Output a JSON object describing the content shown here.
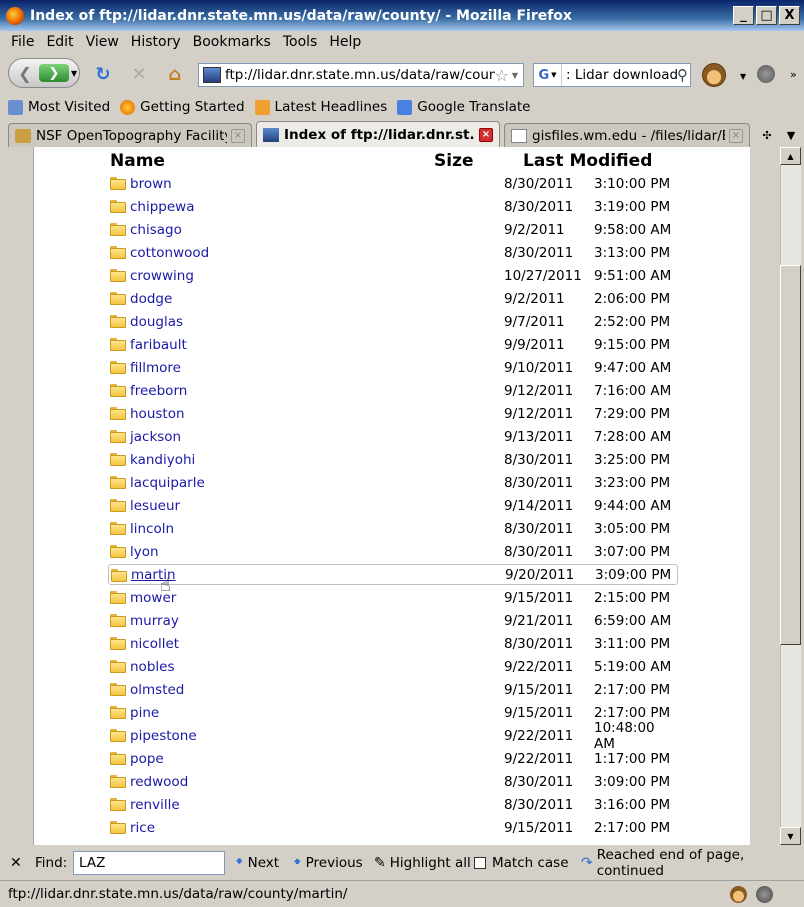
{
  "window": {
    "title": "Index of ftp://lidar.dnr.state.mn.us/data/raw/county/ - Mozilla Firefox",
    "minimize": "_",
    "maximize": "□",
    "close": "X"
  },
  "menu": [
    "File",
    "Edit",
    "View",
    "History",
    "Bookmarks",
    "Tools",
    "Help"
  ],
  "nav": {
    "url": "ftp://lidar.dnr.state.mn.us/data/raw/coun",
    "search_value": ": Lidar download",
    "search_engine": "G"
  },
  "bookmarks": [
    "Most Visited",
    "Getting Started",
    "Latest Headlines",
    "Google Translate"
  ],
  "tabs": [
    {
      "label": "NSF OpenTopography Facility",
      "active": false
    },
    {
      "label": "Index of ftp://lidar.dnr.st...",
      "active": true
    },
    {
      "label": "gisfiles.wm.edu - /files/lidar/ES...",
      "active": false
    }
  ],
  "listing": {
    "headers": {
      "name": "Name",
      "size": "Size",
      "modified": "Last Modified"
    },
    "rows": [
      {
        "name": "brown",
        "date": "8/30/2011",
        "time": "3:10:00 PM"
      },
      {
        "name": "chippewa",
        "date": "8/30/2011",
        "time": "3:19:00 PM"
      },
      {
        "name": "chisago",
        "date": "9/2/2011",
        "time": "9:58:00 AM"
      },
      {
        "name": "cottonwood",
        "date": "8/30/2011",
        "time": "3:13:00 PM"
      },
      {
        "name": "crowwing",
        "date": "10/27/2011",
        "time": "9:51:00 AM"
      },
      {
        "name": "dodge",
        "date": "9/2/2011",
        "time": "2:06:00 PM"
      },
      {
        "name": "douglas",
        "date": "9/7/2011",
        "time": "2:52:00 PM"
      },
      {
        "name": "faribault",
        "date": "9/9/2011",
        "time": "9:15:00 PM"
      },
      {
        "name": "fillmore",
        "date": "9/10/2011",
        "time": "9:47:00 AM"
      },
      {
        "name": "freeborn",
        "date": "9/12/2011",
        "time": "7:16:00 AM"
      },
      {
        "name": "houston",
        "date": "9/12/2011",
        "time": "7:29:00 PM"
      },
      {
        "name": "jackson",
        "date": "9/13/2011",
        "time": "7:28:00 AM"
      },
      {
        "name": "kandiyohi",
        "date": "8/30/2011",
        "time": "3:25:00 PM"
      },
      {
        "name": "lacquiparle",
        "date": "8/30/2011",
        "time": "3:23:00 PM"
      },
      {
        "name": "lesueur",
        "date": "9/14/2011",
        "time": "9:44:00 AM"
      },
      {
        "name": "lincoln",
        "date": "8/30/2011",
        "time": "3:05:00 PM"
      },
      {
        "name": "lyon",
        "date": "8/30/2011",
        "time": "3:07:00 PM"
      },
      {
        "name": "martin",
        "date": "9/20/2011",
        "time": "3:09:00 PM",
        "hover": true
      },
      {
        "name": "mower",
        "date": "9/15/2011",
        "time": "2:15:00 PM"
      },
      {
        "name": "murray",
        "date": "9/21/2011",
        "time": "6:59:00 AM"
      },
      {
        "name": "nicollet",
        "date": "8/30/2011",
        "time": "3:11:00 PM"
      },
      {
        "name": "nobles",
        "date": "9/22/2011",
        "time": "5:19:00 AM"
      },
      {
        "name": "olmsted",
        "date": "9/15/2011",
        "time": "2:17:00 PM"
      },
      {
        "name": "pine",
        "date": "9/15/2011",
        "time": "2:17:00 PM"
      },
      {
        "name": "pipestone",
        "date": "9/22/2011",
        "time": "10:48:00 AM"
      },
      {
        "name": "pope",
        "date": "9/22/2011",
        "time": "1:17:00 PM"
      },
      {
        "name": "redwood",
        "date": "8/30/2011",
        "time": "3:09:00 PM"
      },
      {
        "name": "renville",
        "date": "8/30/2011",
        "time": "3:16:00 PM"
      },
      {
        "name": "rice",
        "date": "9/15/2011",
        "time": "2:17:00 PM"
      }
    ]
  },
  "findbar": {
    "label": "Find:",
    "value": "LAZ",
    "next": "Next",
    "previous": "Previous",
    "highlight": "Highlight all",
    "match_case": "Match case",
    "status": "Reached end of page, continued"
  },
  "status": {
    "text": "ftp://lidar.dnr.state.mn.us/data/raw/county/martin/"
  },
  "colors": {
    "link": "#1a1aa6",
    "titlebar": "#0a246a"
  }
}
